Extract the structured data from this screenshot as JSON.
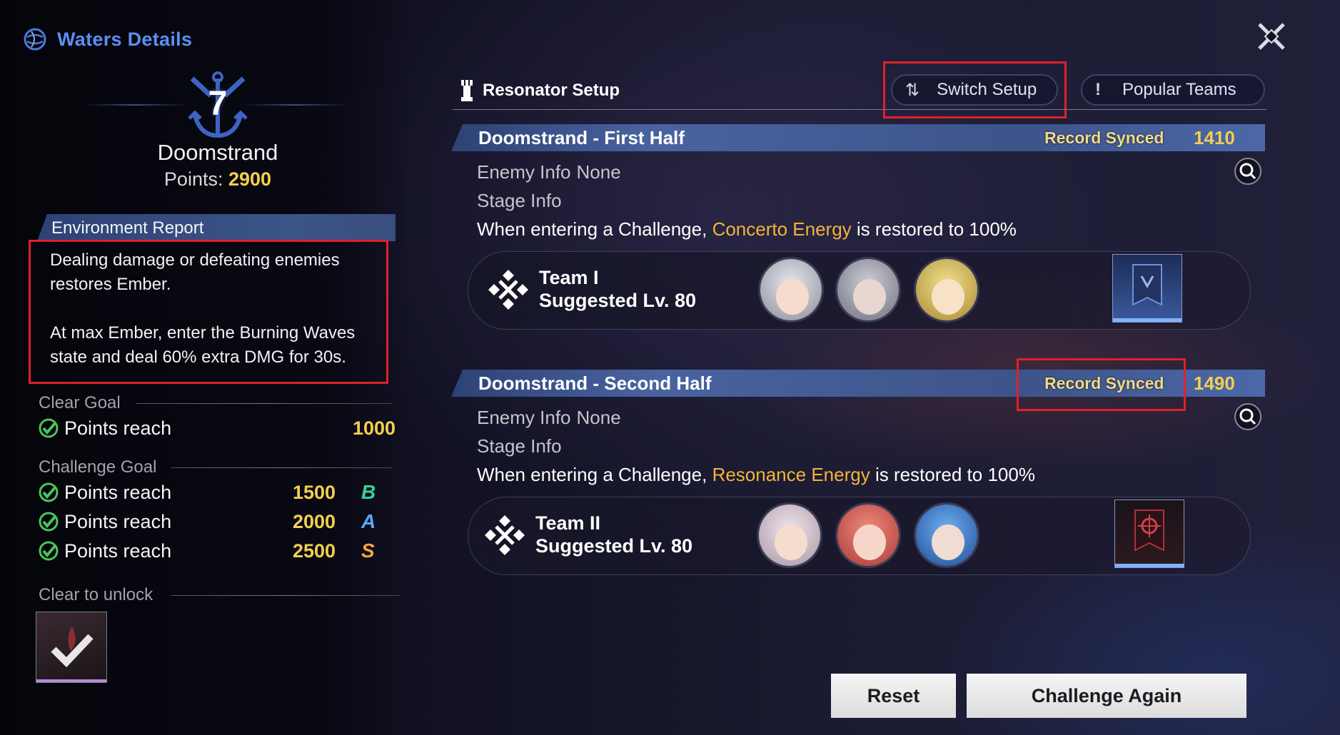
{
  "header": {
    "title": "Waters Details"
  },
  "stage": {
    "number": "7",
    "name": "Doomstrand",
    "points_label": "Points:",
    "points_value": "2900"
  },
  "environment": {
    "title": "Environment Report",
    "line1": "Dealing damage or defeating enemies restores Ember.",
    "line2": "At max Ember, enter the Burning Waves state and deal 60% extra DMG for 30s."
  },
  "clear_goal": {
    "title": "Clear Goal",
    "rows": [
      {
        "label": "Points reach",
        "value": "1000"
      }
    ]
  },
  "challenge_goal": {
    "title": "Challenge Goal",
    "rows": [
      {
        "label": "Points reach",
        "value": "1500",
        "rank": "B",
        "rank_color": "#34d39a"
      },
      {
        "label": "Points reach",
        "value": "2000",
        "rank": "A",
        "rank_color": "#5aa8ff"
      },
      {
        "label": "Points reach",
        "value": "2500",
        "rank": "S",
        "rank_color": "#f3a93a"
      }
    ]
  },
  "unlock": {
    "title": "Clear to unlock"
  },
  "resonator": {
    "title": "Resonator Setup",
    "switch_label": "Switch Setup",
    "switch_icon": "⇅",
    "popular_label": "Popular Teams",
    "popular_icon": "!"
  },
  "halves": [
    {
      "title": "Doomstrand - First Half",
      "synced": "Record Synced",
      "points": "1410",
      "enemy_label": "Enemy Info",
      "enemy_value": "None",
      "stage_label": "Stage Info",
      "challenge_pre": "When entering a Challenge,",
      "challenge_hl": "Concerto Energy",
      "challenge_post": "is restored to 100%",
      "team_name": "Team I",
      "team_lv": "Suggested Lv. 80"
    },
    {
      "title": "Doomstrand - Second Half",
      "synced": "Record Synced",
      "points": "1490",
      "enemy_label": "Enemy Info",
      "enemy_value": "None",
      "stage_label": "Stage Info",
      "challenge_pre": "When entering a Challenge,",
      "challenge_hl": "Resonance Energy",
      "challenge_post": "is restored to 100%",
      "team_name": "Team II",
      "team_lv": "Suggested Lv. 80"
    }
  ],
  "buttons": {
    "reset": "Reset",
    "challenge_again": "Challenge Again"
  },
  "colors": {
    "accent_blue": "#5b8ff2",
    "gold": "#f3cf4f",
    "highlight_box": "#e0202a",
    "energy": "#f3b43a"
  }
}
